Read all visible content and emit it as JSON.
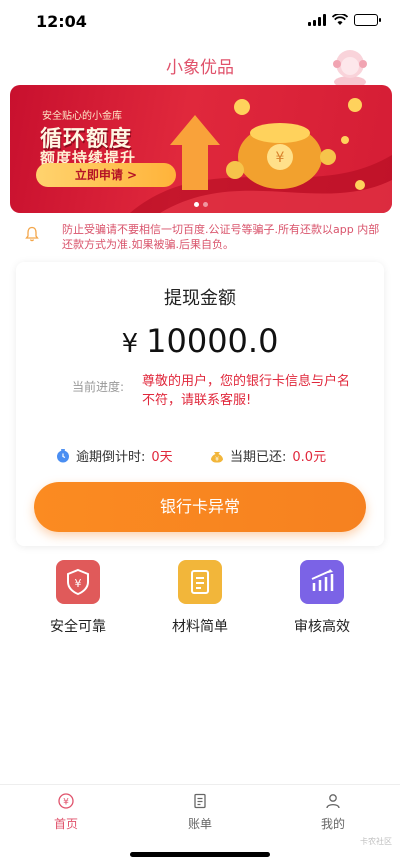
{
  "status": {
    "time": "12:04"
  },
  "header": {
    "title": "小象优品"
  },
  "banner": {
    "kicker": "安全贴心的小金库",
    "headline": "循环额度",
    "subline": "额度持续提升",
    "cta": "立即申请 >"
  },
  "notice": {
    "text": "防止受骗请不要相信一切百度.公证号等骗子.所有还款以app 内部还款方式为准.如果被骗.后果自负。"
  },
  "card": {
    "label": "提现金额",
    "currency": "¥",
    "amount": "10000.0",
    "progress_label": "当前进度:",
    "progress_text": "尊敬的用户，您的银行卡信息与户名不符，请联系客服!",
    "overdue_label": "逾期倒计时:",
    "overdue_value": "0天",
    "repaid_label": "当期已还:",
    "repaid_value": "0.0元",
    "button": "银行卡异常"
  },
  "features": [
    {
      "label": "安全可靠",
      "icon": "shield-yen-icon",
      "color": "#e05a5a"
    },
    {
      "label": "材料简单",
      "icon": "document-icon",
      "color": "#f2b63a"
    },
    {
      "label": "审核高效",
      "icon": "chart-icon",
      "color": "#7b63e6"
    }
  ],
  "tabs": [
    {
      "label": "首页",
      "icon": "home-yen-icon",
      "active": true
    },
    {
      "label": "账单",
      "icon": "bill-icon",
      "active": false
    },
    {
      "label": "我的",
      "icon": "user-icon",
      "active": false
    }
  ],
  "watermark": "卡农社区",
  "colors": {
    "accent": "#e0526b",
    "orange": "#f68120",
    "red": "#e0283c"
  }
}
